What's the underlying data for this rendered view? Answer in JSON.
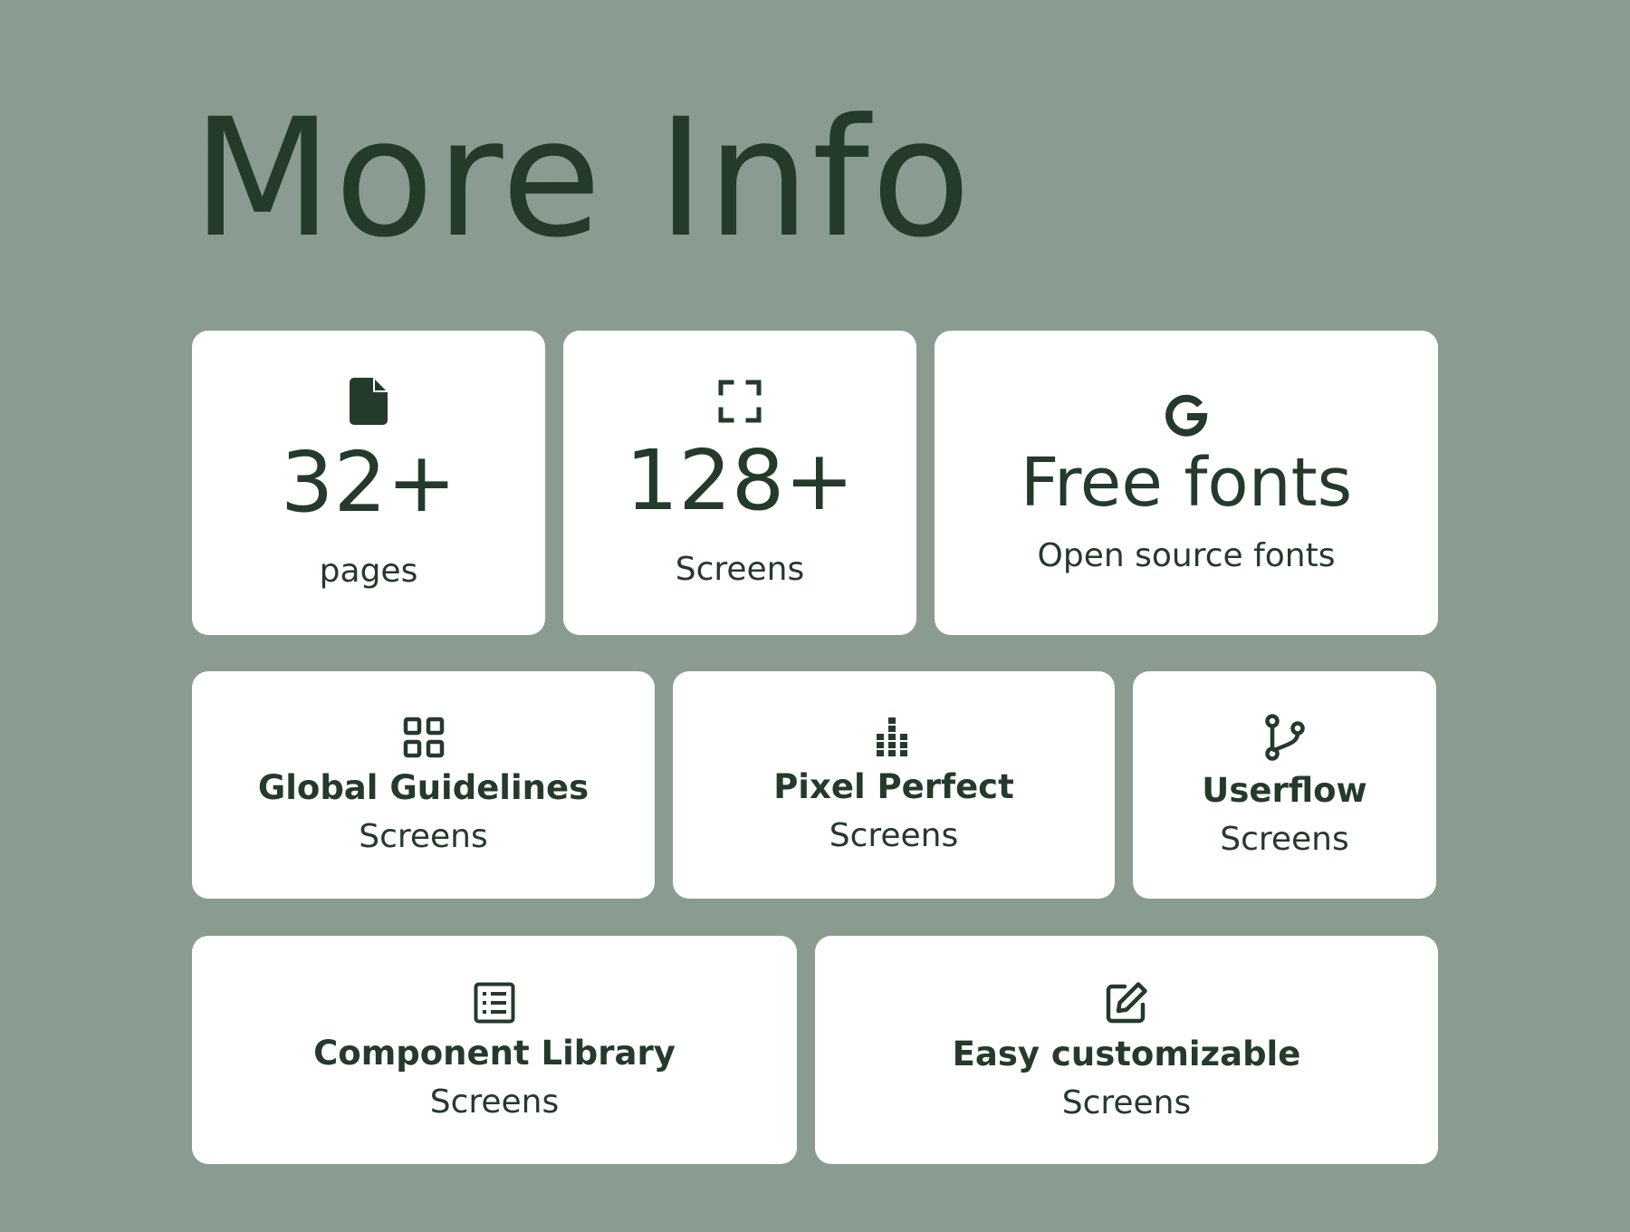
{
  "page": {
    "title": "More Info"
  },
  "stats": [
    {
      "icon": "file-icon",
      "value": "32+",
      "label": "pages"
    },
    {
      "icon": "fullscreen-icon",
      "value": "128+",
      "label": "Screens"
    },
    {
      "icon": "google-icon",
      "value": "Free fonts",
      "label": "Open source fonts"
    }
  ],
  "features": [
    {
      "icon": "grid-icon",
      "title": "Global Guidelines",
      "subtitle": "Screens"
    },
    {
      "icon": "dot-grid-icon",
      "title": "Pixel Perfect",
      "subtitle": "Screens"
    },
    {
      "icon": "git-branch-icon",
      "title": "Userflow",
      "subtitle": "Screens"
    },
    {
      "icon": "list-icon",
      "title": "Component Library",
      "subtitle": "Screens"
    },
    {
      "icon": "edit-icon",
      "title": "Easy customizable",
      "subtitle": "Screens"
    }
  ],
  "colors": {
    "background": "#8a9c90",
    "card": "#ffffff",
    "text": "#243a2b"
  }
}
